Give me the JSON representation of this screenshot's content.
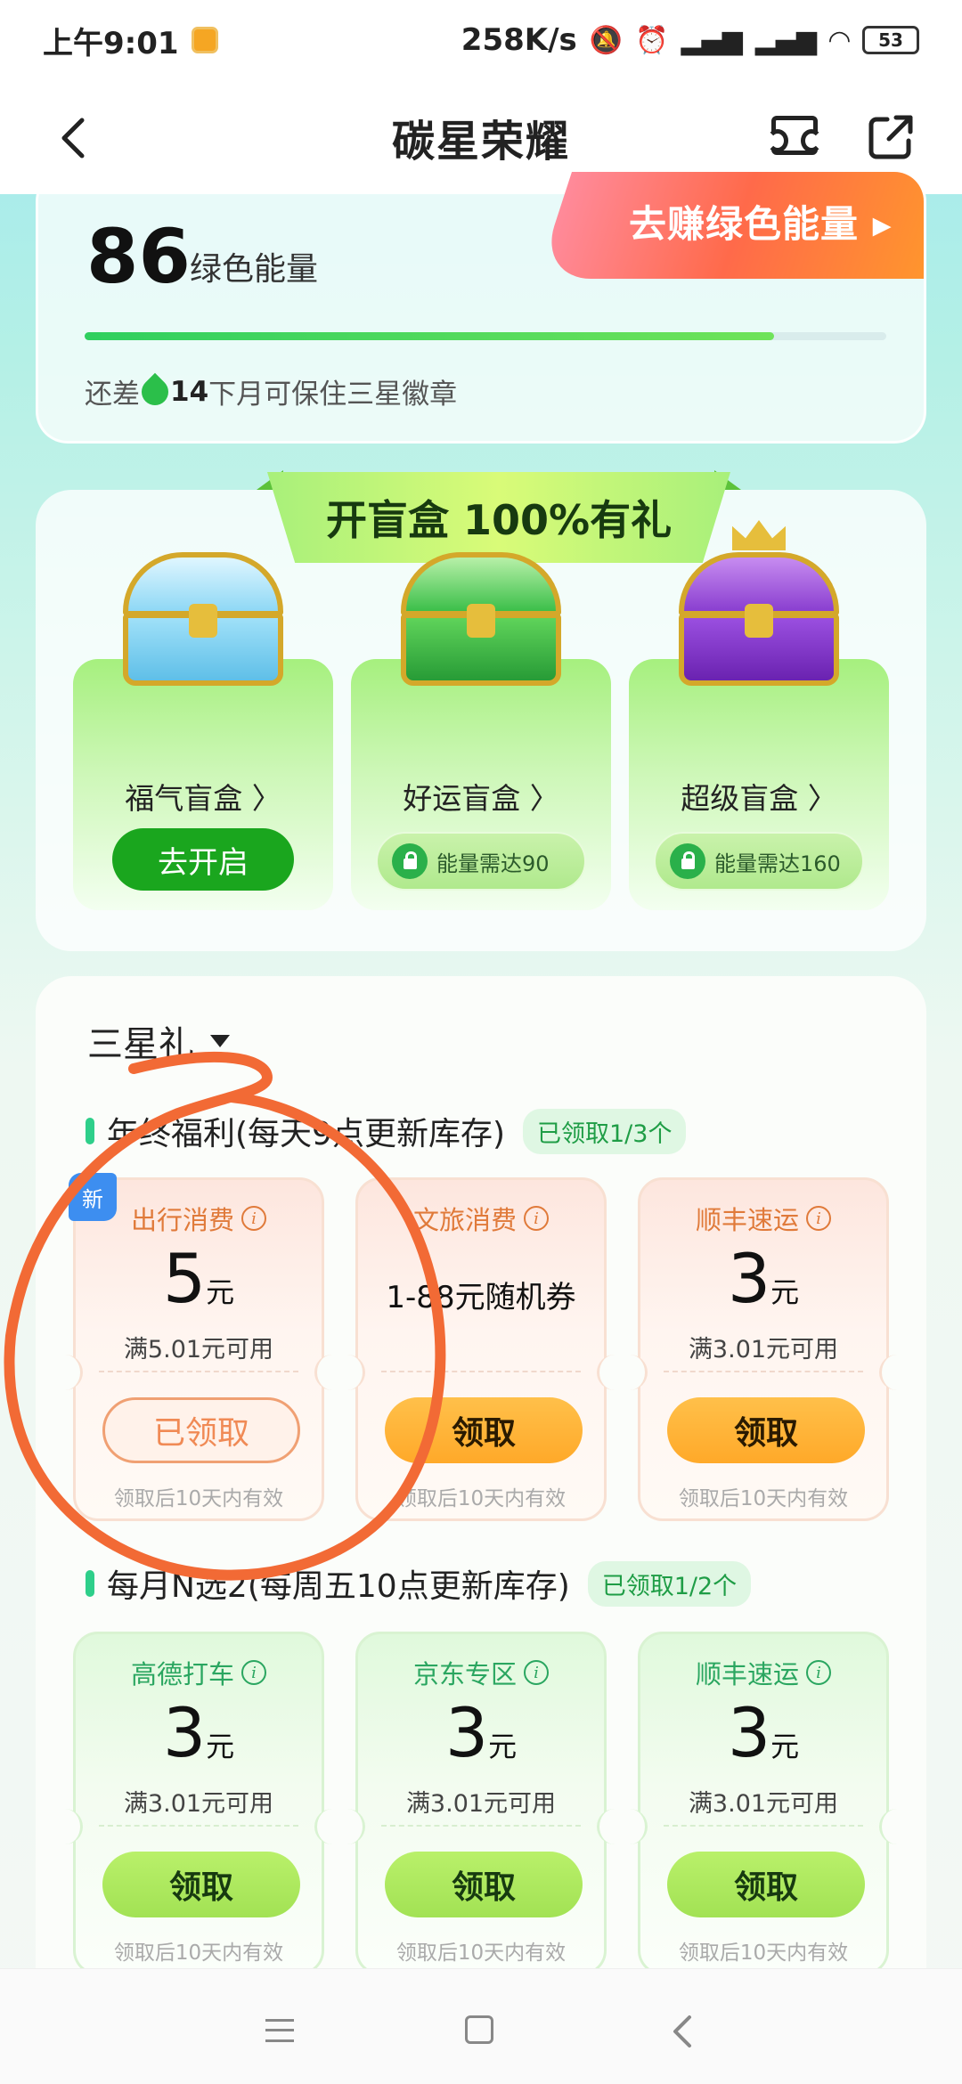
{
  "status_bar": {
    "time": "上午9:01",
    "net_speed": "258K/s",
    "battery": "53",
    "icons": [
      "app-notification-icon",
      "mute-icon",
      "alarm-icon",
      "signal-hd-icon",
      "signal-hd-icon",
      "wifi-icon",
      "battery-icon"
    ]
  },
  "nav": {
    "title": "碳星荣耀",
    "back_icon": "back-arrow-icon",
    "ticket_icon": "ticket-icon",
    "share_icon": "share-icon"
  },
  "energy": {
    "value": "86",
    "unit": "绿色能量",
    "earn_button": "去赚绿色能量 ▸",
    "progress_fraction": 0.86,
    "hint_prefix": "还差",
    "hint_amount": "14",
    "hint_suffix": "下月可保住三星徽章"
  },
  "blind_boxes": {
    "banner": "开盲盒 100%有礼",
    "items": [
      {
        "name": "福气盲盒 〉",
        "action": "去开启",
        "locked": false,
        "color": "#7fd0f0"
      },
      {
        "name": "好运盲盒 〉",
        "action": "能量需达90",
        "locked": true,
        "color": "#3cbf4a"
      },
      {
        "name": "超级盲盒 〉",
        "action": "能量需达160",
        "locked": true,
        "color": "#8a3fd0"
      }
    ]
  },
  "gifts": {
    "tier": "三星礼",
    "sections": [
      {
        "title": "年终福利(每天9点更新库存)",
        "badge": "已领取1/3个",
        "coupons": [
          {
            "category": "出行消费",
            "amount": "5",
            "unit": "元",
            "condition": "满5.01元可用",
            "button": "已领取",
            "validity": "领取后10天内有效",
            "new_badge": "新"
          },
          {
            "category": "文旅消费",
            "random_text": "1-88元随机券",
            "button": "领取",
            "validity": "领取后10天内有效"
          },
          {
            "category": "顺丰速运",
            "amount": "3",
            "unit": "元",
            "condition": "满3.01元可用",
            "button": "领取",
            "validity": "领取后10天内有效"
          }
        ]
      },
      {
        "title": "每月N选2(每周五10点更新库存)",
        "badge": "已领取1/2个",
        "coupons": [
          {
            "category": "高德打车",
            "amount": "3",
            "unit": "元",
            "condition": "满3.01元可用",
            "button": "领取",
            "validity": "领取后10天内有效"
          },
          {
            "category": "京东专区",
            "amount": "3",
            "unit": "元",
            "condition": "满3.01元可用",
            "button": "领取",
            "validity": "领取后10天内有效"
          },
          {
            "category": "顺丰速运",
            "amount": "3",
            "unit": "元",
            "condition": "满3.01元可用",
            "button": "领取",
            "validity": "领取后10天内有效"
          }
        ]
      }
    ]
  },
  "annotation": {
    "color": "#f26a35"
  },
  "system_nav": [
    "menu-icon",
    "home-icon",
    "back-icon"
  ]
}
